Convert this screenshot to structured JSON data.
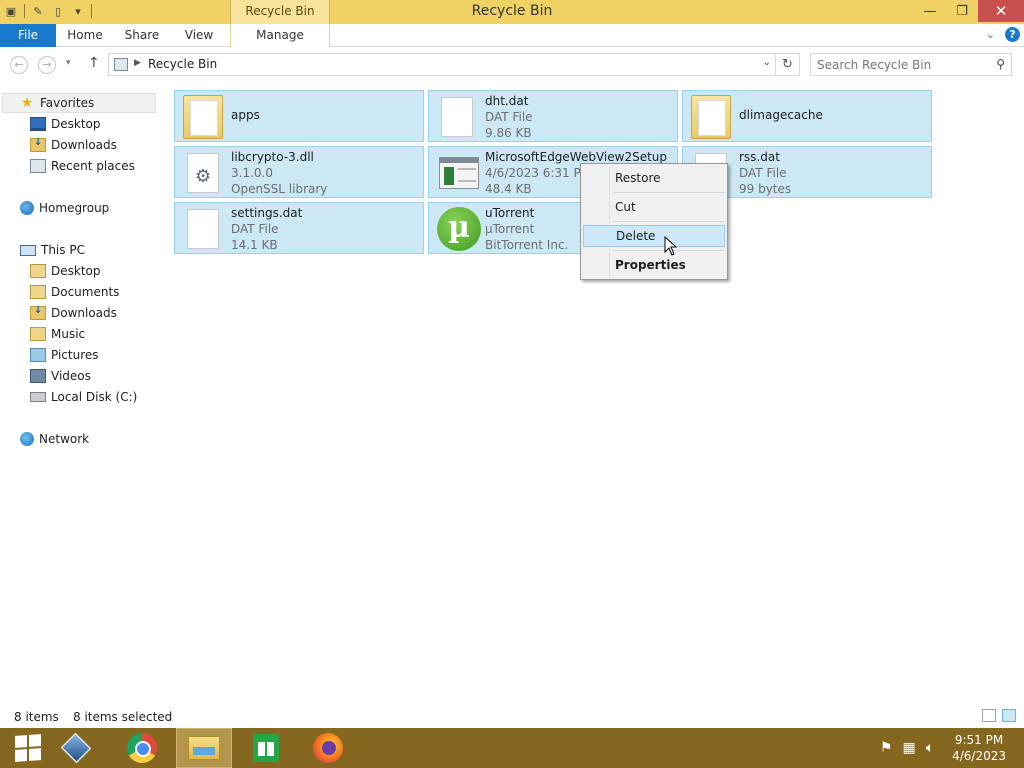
{
  "window": {
    "title": "Recycle Bin",
    "context_tab_group": "Recycle Bin Tools",
    "minimize": "—",
    "restore": "❐",
    "close": "✕"
  },
  "ribbon": {
    "tabs": [
      "File",
      "Home",
      "Share",
      "View",
      "Manage"
    ]
  },
  "address": {
    "path": "Recycle Bin",
    "search_placeholder": "Search Recycle Bin"
  },
  "nav": {
    "favorites": {
      "label": "Favorites",
      "items": [
        "Desktop",
        "Downloads",
        "Recent places"
      ]
    },
    "homegroup": "Homegroup",
    "this_pc": {
      "label": "This PC",
      "items": [
        "Desktop",
        "Documents",
        "Downloads",
        "Music",
        "Pictures",
        "Videos",
        "Local Disk (C:)"
      ]
    },
    "network": "Network"
  },
  "files": [
    {
      "name": "apps",
      "line2": "",
      "line3": "",
      "icon": "folder-icon"
    },
    {
      "name": "dht.dat",
      "line2": "DAT File",
      "line3": "9.86 KB",
      "icon": "file-icon"
    },
    {
      "name": "dlimagecache",
      "line2": "",
      "line3": "",
      "icon": "folder-icon"
    },
    {
      "name": "libcrypto-3.dll",
      "line2": "3.1.0.0",
      "line3": "OpenSSL library",
      "icon": "dll-icon"
    },
    {
      "name": "MicrosoftEdgeWebView2Setup",
      "line2": "4/6/2023 6:31 PM",
      "line3": "48.4 KB",
      "icon": "setup-icon"
    },
    {
      "name": "rss.dat",
      "line2": "DAT File",
      "line3": "99 bytes",
      "icon": "file-icon"
    },
    {
      "name": "settings.dat",
      "line2": "DAT File",
      "line3": "14.1 KB",
      "icon": "file-icon"
    },
    {
      "name": "uTorrent",
      "line2": "µTorrent",
      "line3": "BitTorrent Inc.",
      "icon": "utorrent-icon"
    }
  ],
  "context_menu": {
    "items": [
      "Restore",
      "Cut",
      "Delete",
      "Properties"
    ],
    "highlighted": "Delete"
  },
  "status": {
    "item_count": "8 items",
    "selected": "8 items selected"
  },
  "taskbar": {
    "time": "9:51 PM",
    "date": "4/6/2023"
  }
}
